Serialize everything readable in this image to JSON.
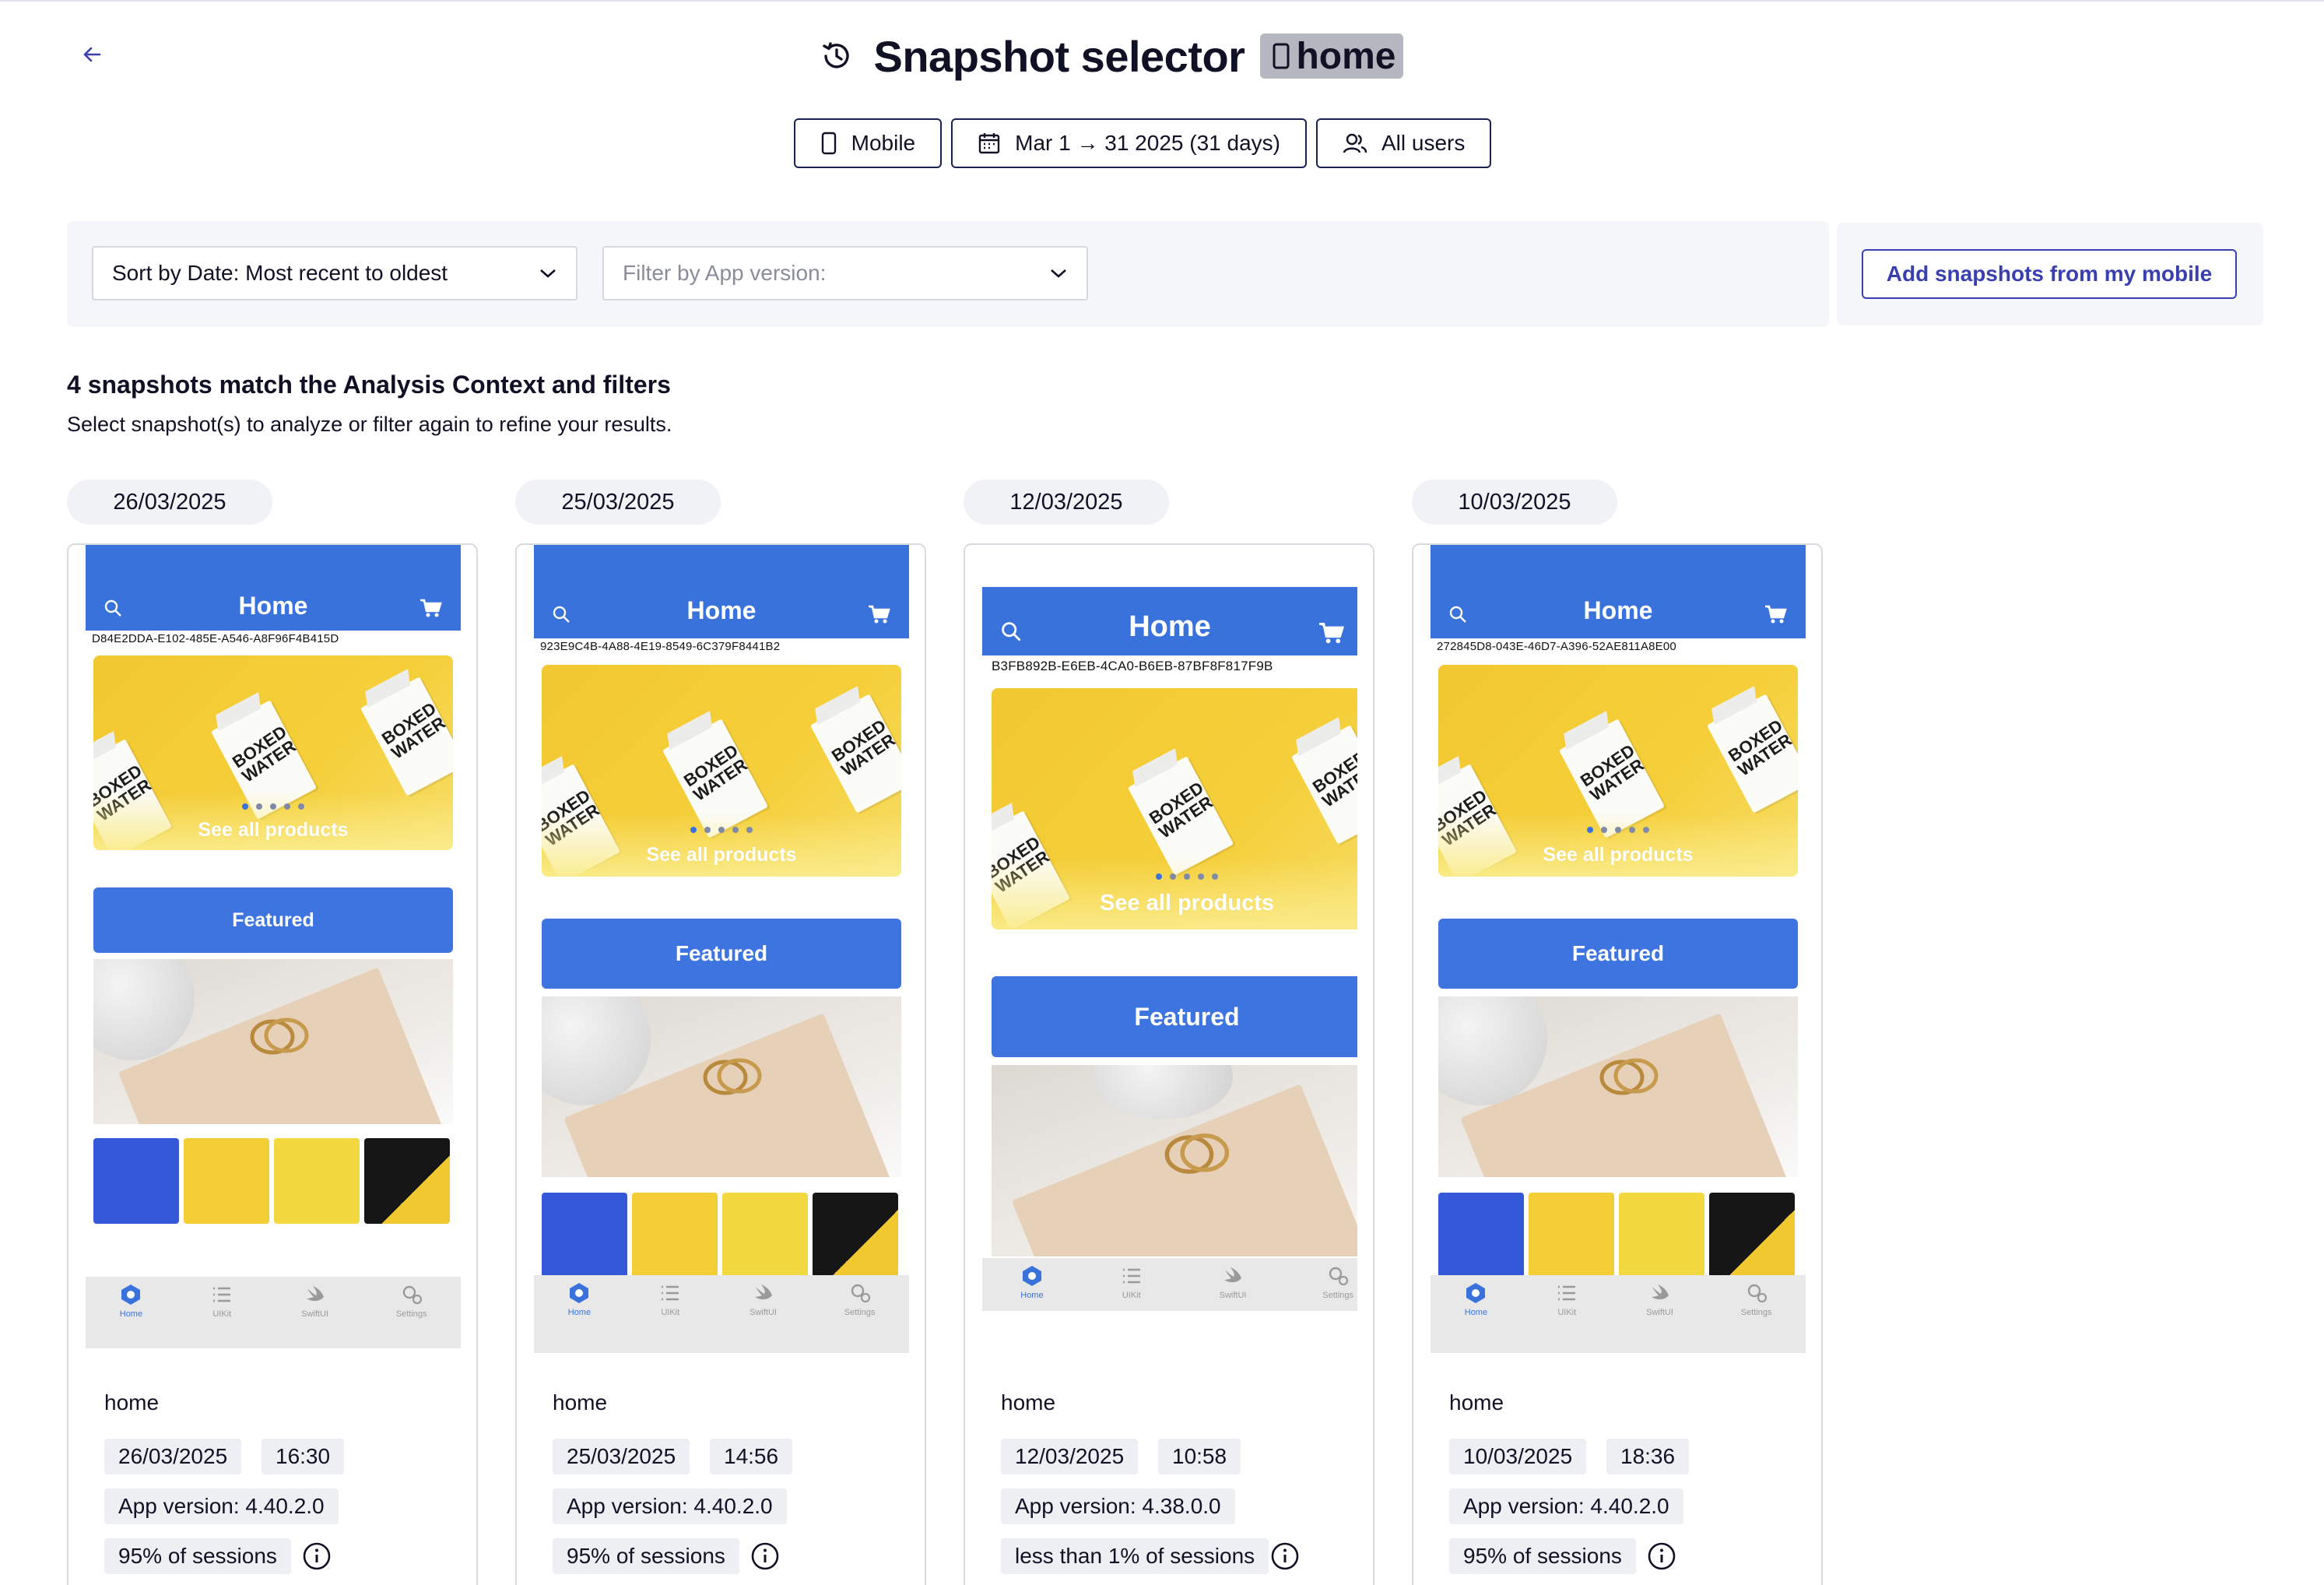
{
  "header": {
    "title": "Snapshot selector",
    "page_name": "home"
  },
  "context": {
    "device": "Mobile",
    "date_range": "Mar 1 → 31 2025 (31 days)",
    "segment": "All users"
  },
  "filters": {
    "sort_value": "Sort by Date: Most recent to oldest",
    "app_version_placeholder": "Filter by App version:",
    "add_button": "Add snapshots from my mobile"
  },
  "results": {
    "heading": "4 snapshots match the Analysis Context and filters",
    "subheading": "Select snapshot(s) to analyze or filter again to refine your results."
  },
  "snapshots": [
    {
      "date_pill": "26/03/2025",
      "screen_title": "Home",
      "uuid": "D84E2DDA-E102-485E-A546-A8F96F4B415D",
      "see_all": "See all products",
      "featured": "Featured",
      "tabs": [
        "Home",
        "UIKit",
        "SwiftUI",
        "Settings"
      ],
      "name": "home",
      "date": "26/03/2025",
      "time": "16:30",
      "app_version": "App version: 4.40.2.0",
      "sessions": "95% of sessions"
    },
    {
      "date_pill": "25/03/2025",
      "screen_title": "Home",
      "uuid": "923E9C4B-4A88-4E19-8549-6C379F8441B2",
      "see_all": "See all products",
      "featured": "Featured",
      "tabs": [
        "Home",
        "UIKit",
        "SwiftUI",
        "Settings"
      ],
      "name": "home",
      "date": "25/03/2025",
      "time": "14:56",
      "app_version": "App version: 4.40.2.0",
      "sessions": "95% of sessions"
    },
    {
      "date_pill": "12/03/2025",
      "screen_title": "Home",
      "uuid": "B3FB892B-E6EB-4CA0-B6EB-87BF8F817F9B",
      "see_all": "See all products",
      "featured": "Featured",
      "tabs": [
        "Home",
        "UIKit",
        "SwiftUI",
        "Settings"
      ],
      "name": "home",
      "date": "12/03/2025",
      "time": "10:58",
      "app_version": "App version: 4.38.0.0",
      "sessions": "less than 1% of sessions"
    },
    {
      "date_pill": "10/03/2025",
      "screen_title": "Home",
      "uuid": "272845D8-043E-46D7-A396-52AE811A8E00",
      "see_all": "See all products",
      "featured": "Featured",
      "tabs": [
        "Home",
        "UIKit",
        "SwiftUI",
        "Settings"
      ],
      "name": "home",
      "date": "10/03/2025",
      "time": "18:36",
      "app_version": "App version: 4.40.2.0",
      "sessions": "95% of sessions"
    }
  ],
  "colors": {
    "accent": "#3a3fb0",
    "app_blue": "#3a72dc",
    "hero_yellow": "#f2c830"
  }
}
